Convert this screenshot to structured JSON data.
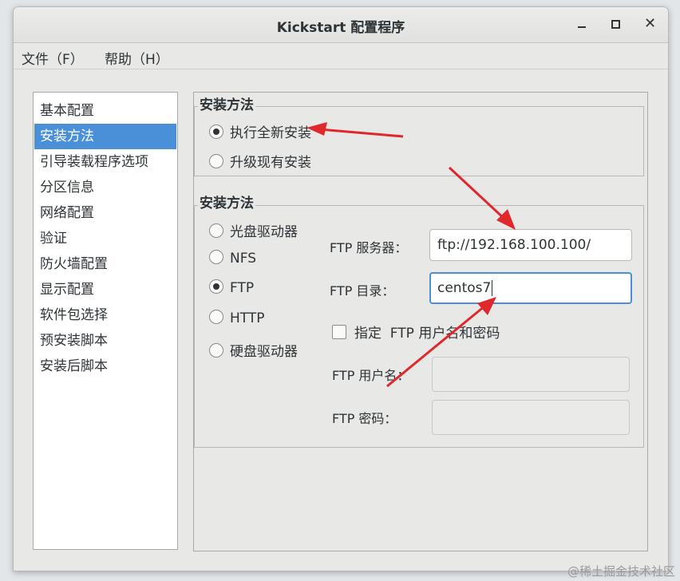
{
  "window": {
    "title": "Kickstart 配置程序",
    "controls": {
      "minimize": "minimize-icon",
      "maximize": "maximize-icon",
      "close": "close-icon"
    }
  },
  "menubar": {
    "file": "文件（F）",
    "help": "帮助（H）"
  },
  "sidebar": {
    "items": [
      {
        "label": "基本配置"
      },
      {
        "label": "安装方法"
      },
      {
        "label": "引导装载程序选项"
      },
      {
        "label": "分区信息"
      },
      {
        "label": "网络配置"
      },
      {
        "label": "验证"
      },
      {
        "label": "防火墙配置"
      },
      {
        "label": "显示配置"
      },
      {
        "label": "软件包选择"
      },
      {
        "label": "预安装脚本"
      },
      {
        "label": "安装后脚本"
      }
    ],
    "selected_index": 1
  },
  "install_type": {
    "title": "安装方法",
    "options": [
      {
        "label": "执行全新安装",
        "checked": true
      },
      {
        "label": "升级现有安装",
        "checked": false
      }
    ]
  },
  "install_method": {
    "title": "安装方法",
    "options": [
      {
        "label": "光盘驱动器",
        "checked": false
      },
      {
        "label": "NFS",
        "checked": false
      },
      {
        "label": "FTP",
        "checked": true
      },
      {
        "label": "HTTP",
        "checked": false
      },
      {
        "label": "硬盘驱动器",
        "checked": false
      }
    ],
    "ftp_server_label": "FTP 服务器：",
    "ftp_server_value": "ftp://192.168.100.100/",
    "ftp_dir_label": "FTP 目录：",
    "ftp_dir_value": "centos7",
    "credentials_checkbox_label": "指定  FTP 用户名和密码",
    "credentials_checked": false,
    "ftp_user_label": "FTP 用户名：",
    "ftp_user_value": "",
    "ftp_password_label": "FTP 密码：",
    "ftp_password_value": ""
  },
  "annotations": {
    "arrow_color": "#e0272b"
  },
  "watermark": "@稀土掘金技术社区"
}
